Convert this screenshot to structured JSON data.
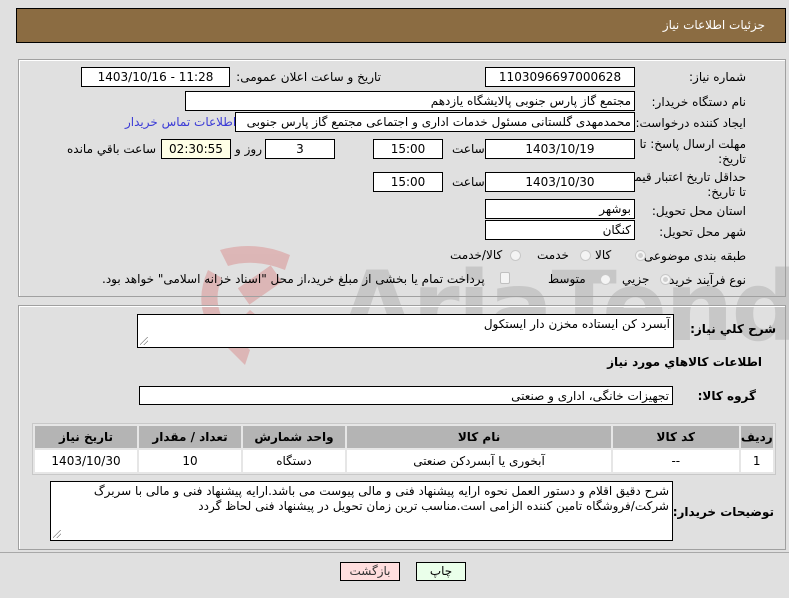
{
  "header": {
    "title": "جزئیات اطلاعات نیاز"
  },
  "form": {
    "need_number": {
      "label": "شماره نیاز:",
      "value": "1103096697000628"
    },
    "announce_datetime": {
      "label": "تاریخ و ساعت اعلان عمومی:",
      "value": "1403/10/16 - 11:28"
    },
    "buyer_org": {
      "label": "نام دستگاه خریدار:",
      "value": "مجتمع گاز پارس جنوبی  پالایشگاه یازدهم"
    },
    "requester": {
      "label": "ایجاد کننده درخواست:",
      "value": "محمدمهدی گلستانی مسئول خدمات اداری و اجتماعی مجتمع گاز پارس جنوبی",
      "contact_link": "اطلاعات تماس خریدار"
    },
    "reply_deadline": {
      "label": "مهلت ارسال پاسخ: تا تاریخ:",
      "date": "1403/10/19",
      "time_label": "ساعت",
      "time": "15:00",
      "days": "3",
      "days_label": "روز و",
      "remaining": "02:30:55",
      "remaining_label": "ساعت باقي مانده"
    },
    "price_validity": {
      "label": "حداقل تاریخ اعتبار قیمت: تا تاریخ:",
      "date": "1403/10/30",
      "time_label": "ساعت",
      "time": "15:00"
    },
    "province": {
      "label": "استان محل تحویل:",
      "value": "بوشهر"
    },
    "city": {
      "label": "شهر محل تحویل:",
      "value": "کنگان"
    },
    "category": {
      "label": "طبقه بندی موضوعی:",
      "options": [
        "کالا",
        "خدمت",
        "کالا/خدمت"
      ],
      "selected": "کالا"
    },
    "purchase_type": {
      "label": "نوع فرآیند خرید :",
      "options": [
        "جزیي",
        "متوسط"
      ],
      "selected": "جزیي",
      "treasury_checkbox_label": "پرداخت تمام یا بخشی از مبلغ خرید،از محل \"اسناد خزانه اسلامی\" خواهد بود.",
      "treasury_checked": false
    }
  },
  "details": {
    "general_desc_label": "شرح کلي نياز:",
    "general_desc": "آبسرد کن ایستاده مخزن دار ایستکول",
    "items_section_title": "اطلاعات کالاهاي مورد نياز",
    "goods_group_label": "گروه کالا:",
    "goods_group": "تجهیزات خانگی، اداری و صنعتی",
    "table": {
      "headers": [
        "ردیف",
        "کد کالا",
        "نام کالا",
        "واحد شمارش",
        "تعداد / مقدار",
        "تاریخ نیاز"
      ],
      "rows": [
        [
          "1",
          "--",
          "آبخوری یا آبسردکن صنعتی",
          "دستگاه",
          "10",
          "1403/10/30"
        ]
      ]
    },
    "buyer_notes_label": "توضیحات خریدار:",
    "buyer_notes": "شرح دقیق اقلام و دستور العمل نحوه ارایه پیشنهاد فنی و مالی پیوست می باشد.ارایه پیشنهاد فنی و مالی با سربرگ شرکت/فروشگاه تامین کننده الزامی است.مناسب ترین زمان تحویل در پیشنهاد فنی لحاظ گردد"
  },
  "buttons": {
    "print": "چاپ",
    "back": "بازگشت"
  },
  "watermark": {
    "text": "AriaTender.neT"
  }
}
